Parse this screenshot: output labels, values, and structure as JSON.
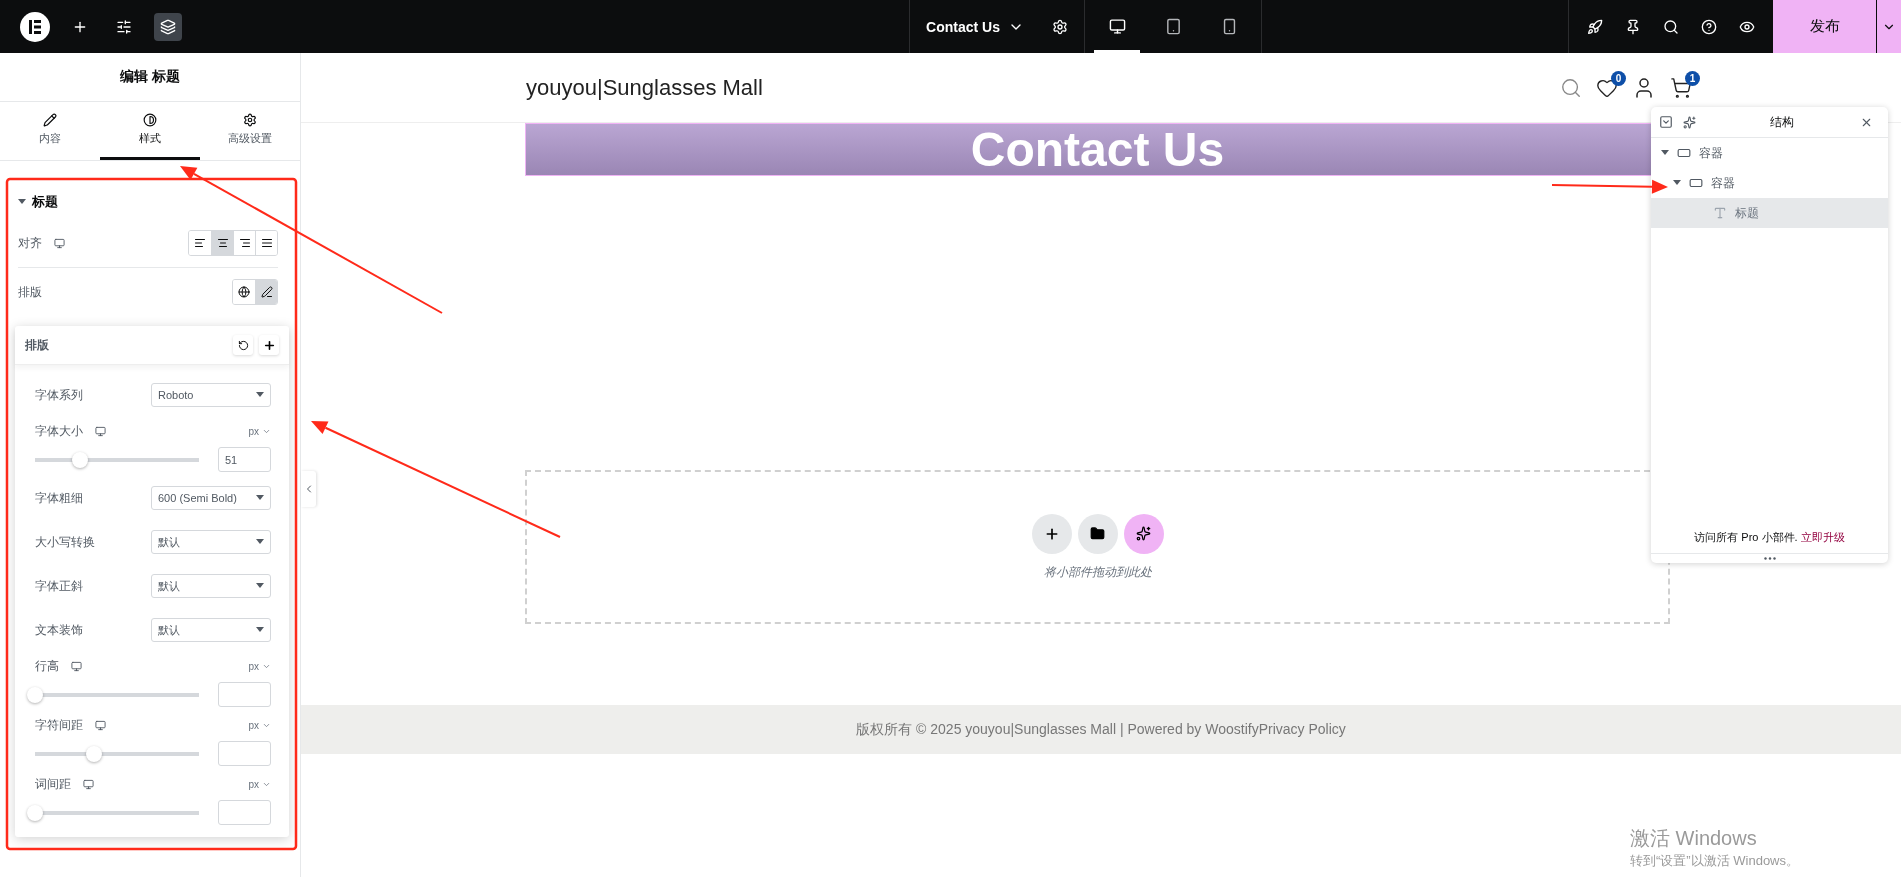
{
  "top_bar": {
    "page_title": "Contact Us",
    "publish_label": "发布",
    "tools": [
      {
        "kind": "add",
        "selected": false
      },
      {
        "kind": "settings",
        "selected": false
      },
      {
        "kind": "structure",
        "selected": true
      }
    ],
    "view_modes": [
      {
        "kind": "desktop",
        "selected": true
      },
      {
        "kind": "tablet",
        "selected": false
      },
      {
        "kind": "mobile",
        "selected": false
      }
    ]
  },
  "panel": {
    "title": "编辑 标题",
    "tabs": [
      {
        "kind": "content",
        "label": "内容",
        "selected": false
      },
      {
        "kind": "style",
        "label": "样式",
        "selected": true
      },
      {
        "kind": "advanced",
        "label": "高级设置",
        "selected": false
      }
    ],
    "section": {
      "title": "标题",
      "expanded": true
    },
    "align": {
      "label": "对齐",
      "options": [
        {
          "kind": "left",
          "selected": false
        },
        {
          "kind": "center",
          "selected": true
        },
        {
          "kind": "right",
          "selected": false
        },
        {
          "kind": "justify",
          "selected": false
        }
      ]
    },
    "typography": {
      "label": "排版",
      "modes": [
        {
          "kind": "global",
          "selected": false
        },
        {
          "kind": "edit",
          "selected": true
        }
      ]
    },
    "popover": {
      "title": "排版",
      "rows": [
        {
          "kind": "select",
          "label": "字体系列",
          "value": "Roboto",
          "responsive": false
        },
        {
          "kind": "slider",
          "label": "字体大小",
          "unit": "px",
          "level": 0.25,
          "value": "51",
          "responsive": true
        },
        {
          "kind": "select",
          "label": "字体粗细",
          "value": "600 (Semi Bold)",
          "responsive": false
        },
        {
          "kind": "select",
          "label": "大小写转换",
          "value": "默认",
          "responsive": false
        },
        {
          "kind": "select",
          "label": "字体正斜",
          "value": "默认",
          "responsive": false
        },
        {
          "kind": "select",
          "label": "文本装饰",
          "value": "默认",
          "responsive": false
        },
        {
          "kind": "slider",
          "label": "行高",
          "unit": "px",
          "level": 0,
          "responsive": true
        },
        {
          "kind": "slider",
          "label": "字符间距",
          "unit": "px",
          "level": 0.33,
          "responsive": true
        },
        {
          "kind": "slider",
          "label": "词间距",
          "unit": "px",
          "level": 0,
          "responsive": true
        }
      ]
    }
  },
  "canvas": {
    "site_title": "youyou|Sunglasses Mall",
    "wishlist_count": "0",
    "cart_count": "1",
    "heading": "Contact Us",
    "drop_hint": "将小部件拖动到此处",
    "footer_text": "版权所有 © 2025 youyou|Sunglasses Mall | Powered by WoostifyPrivacy Policy"
  },
  "structure": {
    "title": "结构",
    "tree": [
      {
        "label": "容器",
        "expanded": true,
        "selected": false,
        "children": [
          {
            "label": "容器",
            "expanded": true,
            "selected": false,
            "children": [
              {
                "label": "标题",
                "selected": false,
                "highlighted": true
              }
            ]
          }
        ]
      }
    ],
    "promo_text": "访问所有 Pro 小部件.",
    "promo_link": "立即升级"
  },
  "os_notice": {
    "title": "激活 Windows",
    "subtitle": "转到“设置”以激活 Windows。"
  }
}
